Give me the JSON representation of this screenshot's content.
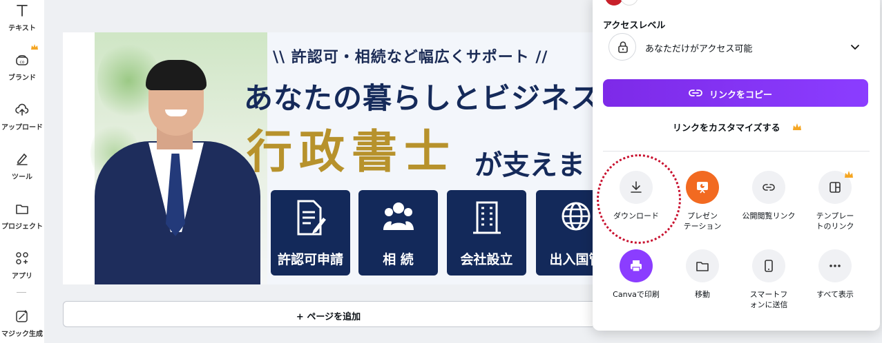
{
  "sidebar": {
    "items": [
      {
        "label": "テキスト",
        "icon": "text-icon"
      },
      {
        "label": "ブランド",
        "icon": "brand-icon",
        "premium": true
      },
      {
        "label": "アップロード",
        "icon": "upload-icon"
      },
      {
        "label": "ツール",
        "icon": "pen-icon"
      },
      {
        "label": "プロジェクト",
        "icon": "folder-icon"
      },
      {
        "label": "アプリ",
        "icon": "apps-icon"
      },
      {
        "label": "マジック生成",
        "icon": "magic-icon"
      }
    ]
  },
  "design": {
    "tagline": "\\\\ 許認可・相続など幅広くサポート //",
    "headline": "あなたの暮らしとビジネス",
    "profession": "行政書士",
    "support": "が支えま",
    "services": [
      {
        "label": "許認可申請",
        "icon": "document-pen-icon"
      },
      {
        "label": "相 続",
        "icon": "people-icon"
      },
      {
        "label": "会社設立",
        "icon": "building-icon"
      },
      {
        "label": "出入国管",
        "icon": "globe-icon"
      }
    ],
    "colors": {
      "navy": "#13295a",
      "gold": "#b7922c"
    }
  },
  "canvas": {
    "add_page_label": "+ ページを追加"
  },
  "share_panel": {
    "access_title": "アクセスレベル",
    "access_value": "あなただけがアクセス可能",
    "copy_link_label": "リンクをコピー",
    "customize_label": "リンクをカスタマイズする",
    "actions": [
      {
        "label": "ダウンロード",
        "icon": "download-icon"
      },
      {
        "label": "プレゼン\nテーション",
        "icon": "presentation-icon"
      },
      {
        "label": "公開閲覧リンク",
        "icon": "link-icon"
      },
      {
        "label": "テンプレー\nトのリンク",
        "icon": "template-icon",
        "premium": true
      },
      {
        "label": "Canvaで印刷",
        "icon": "printer-icon"
      },
      {
        "label": "移動",
        "icon": "folder-icon"
      },
      {
        "label": "スマートフ\nォンに送信",
        "icon": "smartphone-icon"
      },
      {
        "label": "すべて表示",
        "icon": "more-icon"
      }
    ],
    "accent_color": "#8b3dff",
    "highlight_color": "#c8102e"
  }
}
